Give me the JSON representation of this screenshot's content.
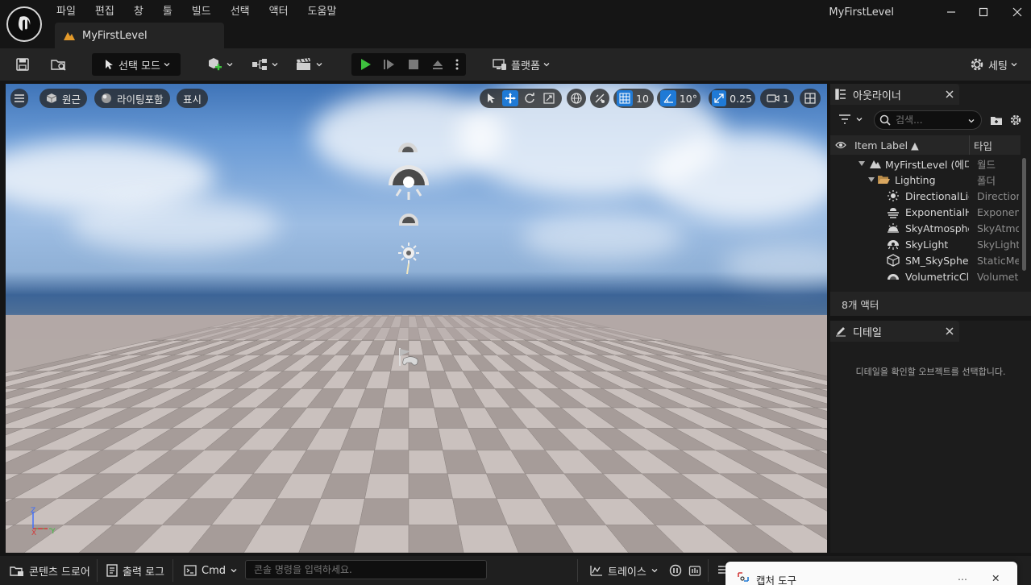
{
  "menu": [
    "파일",
    "편집",
    "창",
    "툴",
    "빌드",
    "선택",
    "액터",
    "도움말"
  ],
  "window": {
    "title": "MyFirstLevel",
    "minimize": "—",
    "maximize": "☐",
    "close": "✕"
  },
  "doc_tab": {
    "label": "MyFirstLevel"
  },
  "toolbar": {
    "select_mode": "선택 모드",
    "platform": "플랫폼",
    "settings": "세팅"
  },
  "viewport": {
    "perspective": "원근",
    "lighting": "라이팅포함",
    "show": "표시",
    "grid_snap": "10",
    "rotation_snap": "10°",
    "scale_snap": "0.25",
    "camera_speed": "1",
    "axis": {
      "z": "Z",
      "x": "X",
      "y": "Y"
    }
  },
  "outliner": {
    "tab_label": "아웃라이너",
    "search_placeholder": "검색...",
    "col_label": "Item Label ▲",
    "col_type": "타입",
    "rows": [
      {
        "label": "MyFirstLevel (에디터)",
        "type": "월드"
      },
      {
        "label": "Lighting",
        "type": "폴더"
      },
      {
        "label": "DirectionalLight",
        "type": "DirectionalLight"
      },
      {
        "label": "ExponentialHeightFog",
        "type": "ExponentialHeightFog"
      },
      {
        "label": "SkyAtmosphere",
        "type": "SkyAtmosphere"
      },
      {
        "label": "SkyLight",
        "type": "SkyLight"
      },
      {
        "label": "SM_SkySphere",
        "type": "StaticMeshActor"
      },
      {
        "label": "VolumetricCloud",
        "type": "VolumetricCloud"
      }
    ],
    "footer": "8개 액터"
  },
  "details": {
    "tab_label": "디테일",
    "empty_msg": "디테일을 확인할 오브젝트를 선택합니다."
  },
  "statusbar": {
    "content_drawer": "콘텐츠 드로어",
    "output_log": "출력 로그",
    "cmd": "Cmd",
    "cmd_placeholder": "콘솔 명령을 입력하세요.",
    "trace": "트레이스"
  },
  "capture_tool": {
    "title": "캡처 도구",
    "more": "...",
    "close": "✕"
  },
  "colors": {
    "accent": "#1f7ad6",
    "play": "#3ec13e",
    "folder": "#d9a760"
  }
}
